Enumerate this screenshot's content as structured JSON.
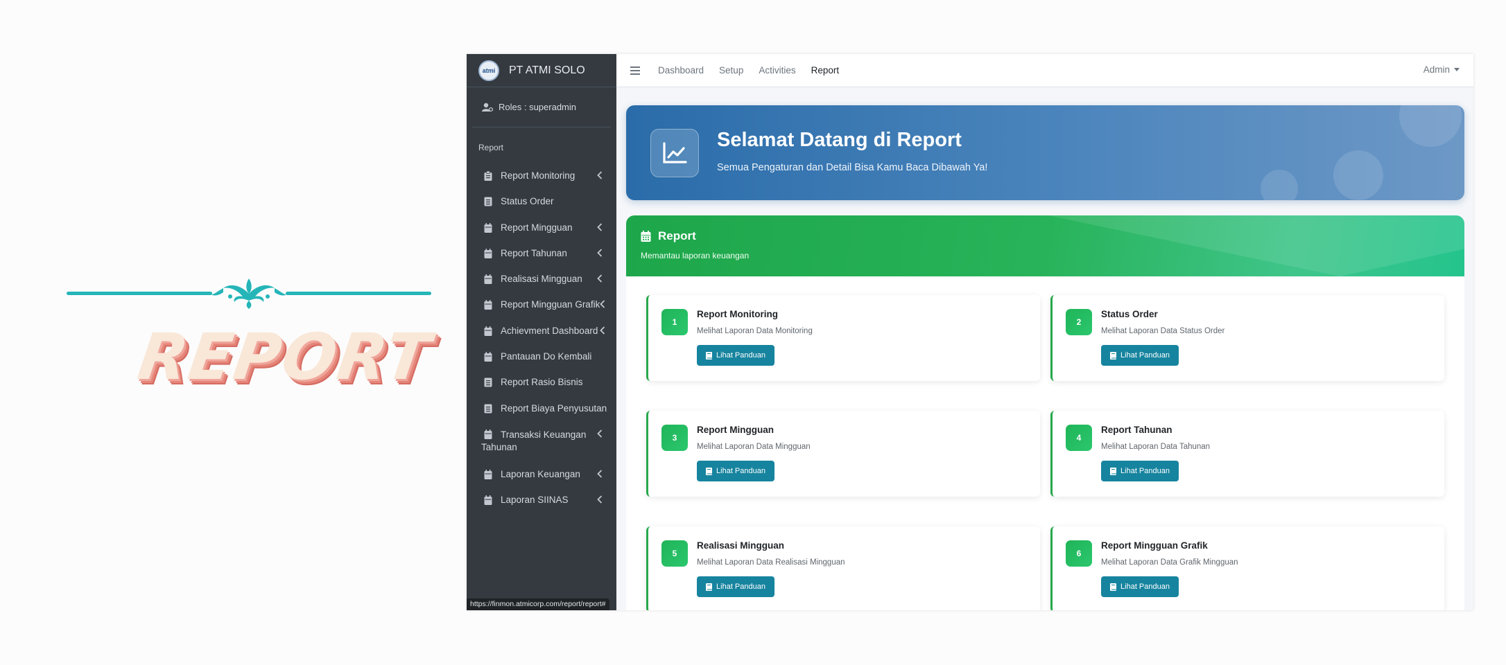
{
  "decor": {
    "title": "REPORT"
  },
  "sidebar": {
    "brand": "PT ATMI SOLO",
    "logo_text": "atmi",
    "roles": "Roles : superadmin",
    "section_header": "Report",
    "items": [
      {
        "label": "Report Monitoring",
        "icon": "clipboard-icon",
        "expandable": true
      },
      {
        "label": "Status Order",
        "icon": "document-icon",
        "expandable": false
      },
      {
        "label": "Report Mingguan",
        "icon": "calendar-icon",
        "expandable": true
      },
      {
        "label": "Report Tahunan",
        "icon": "calendar-icon",
        "expandable": true
      },
      {
        "label": "Realisasi Mingguan",
        "icon": "calendar-icon",
        "expandable": true
      },
      {
        "label": "Report Mingguan Grafik",
        "icon": "calendar-icon",
        "expandable": true
      },
      {
        "label": "Achievment Dashboard",
        "icon": "calendar-icon",
        "expandable": true
      },
      {
        "label": "Pantauan Do Kembali",
        "icon": "calendar-icon",
        "expandable": false
      },
      {
        "label": "Report Rasio Bisnis",
        "icon": "document-icon",
        "expandable": false
      },
      {
        "label": "Report Biaya Penyusutan",
        "icon": "document-icon",
        "expandable": false
      },
      {
        "label": "Transaksi Keuangan Tahunan",
        "icon": "calendar-icon",
        "expandable": true
      },
      {
        "label": "Laporan Keuangan",
        "icon": "calendar-icon",
        "expandable": true
      },
      {
        "label": "Laporan SIINAS",
        "icon": "calendar-icon",
        "expandable": true
      }
    ]
  },
  "status_bar": {
    "url": "https://finmon.atmicorp.com/report/report#"
  },
  "topbar": {
    "nav": [
      "Dashboard",
      "Setup",
      "Activities",
      "Report"
    ],
    "active": "Report",
    "user": "Admin"
  },
  "welcome": {
    "title": "Selamat Datang di Report",
    "subtitle": "Semua Pengaturan dan Detail Bisa Kamu Baca Dibawah Ya!"
  },
  "report_card": {
    "title": "Report",
    "subtitle": "Memantau laporan keuangan",
    "button_label": "Lihat Panduan",
    "items": [
      {
        "num": "1",
        "title": "Report Monitoring",
        "desc": "Melihat Laporan Data Monitoring"
      },
      {
        "num": "2",
        "title": "Status Order",
        "desc": "Melihat Laporan Data Status Order"
      },
      {
        "num": "3",
        "title": "Report Mingguan",
        "desc": "Melihat Laporan Data Mingguan"
      },
      {
        "num": "4",
        "title": "Report Tahunan",
        "desc": "Melihat Laporan Data Tahunan"
      },
      {
        "num": "5",
        "title": "Realisasi Mingguan",
        "desc": "Melihat Laporan Data Realisasi Mingguan"
      },
      {
        "num": "6",
        "title": "Report Mingguan Grafik",
        "desc": "Melihat Laporan Data Grafik Mingguan"
      }
    ]
  },
  "colors": {
    "sidebar_bg": "#343a40",
    "welcome_blue": "#2a6ca9",
    "report_green": "#28b35a",
    "button_teal": "#17849f",
    "decor_teal": "#25b5b8",
    "decor_text": "#f9e7d8"
  }
}
